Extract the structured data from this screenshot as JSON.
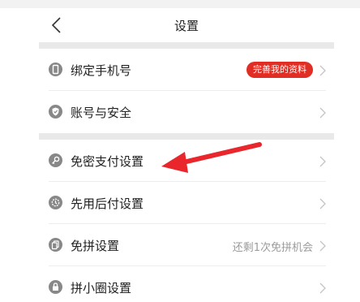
{
  "header": {
    "title": "设置",
    "back_icon": "chevron-left-icon"
  },
  "rows": [
    {
      "icon": "phone-icon",
      "label": "绑定手机号",
      "badge": "完善我的资料"
    },
    {
      "icon": "shield-icon",
      "label": "账号与安全"
    },
    {
      "icon": "key-icon",
      "label": "免密支付设置"
    },
    {
      "icon": "pay-later-icon",
      "label": "先用后付设置"
    },
    {
      "icon": "group-buy-icon",
      "label": "免拼设置",
      "hint": "还剩1次免拼机会"
    },
    {
      "icon": "lock-icon",
      "label": "拼小圈设置"
    }
  ],
  "colors": {
    "badge": "#e02e24",
    "arrow": "#e8262b",
    "icon": "#888888",
    "separator": "#e9e9e9"
  }
}
